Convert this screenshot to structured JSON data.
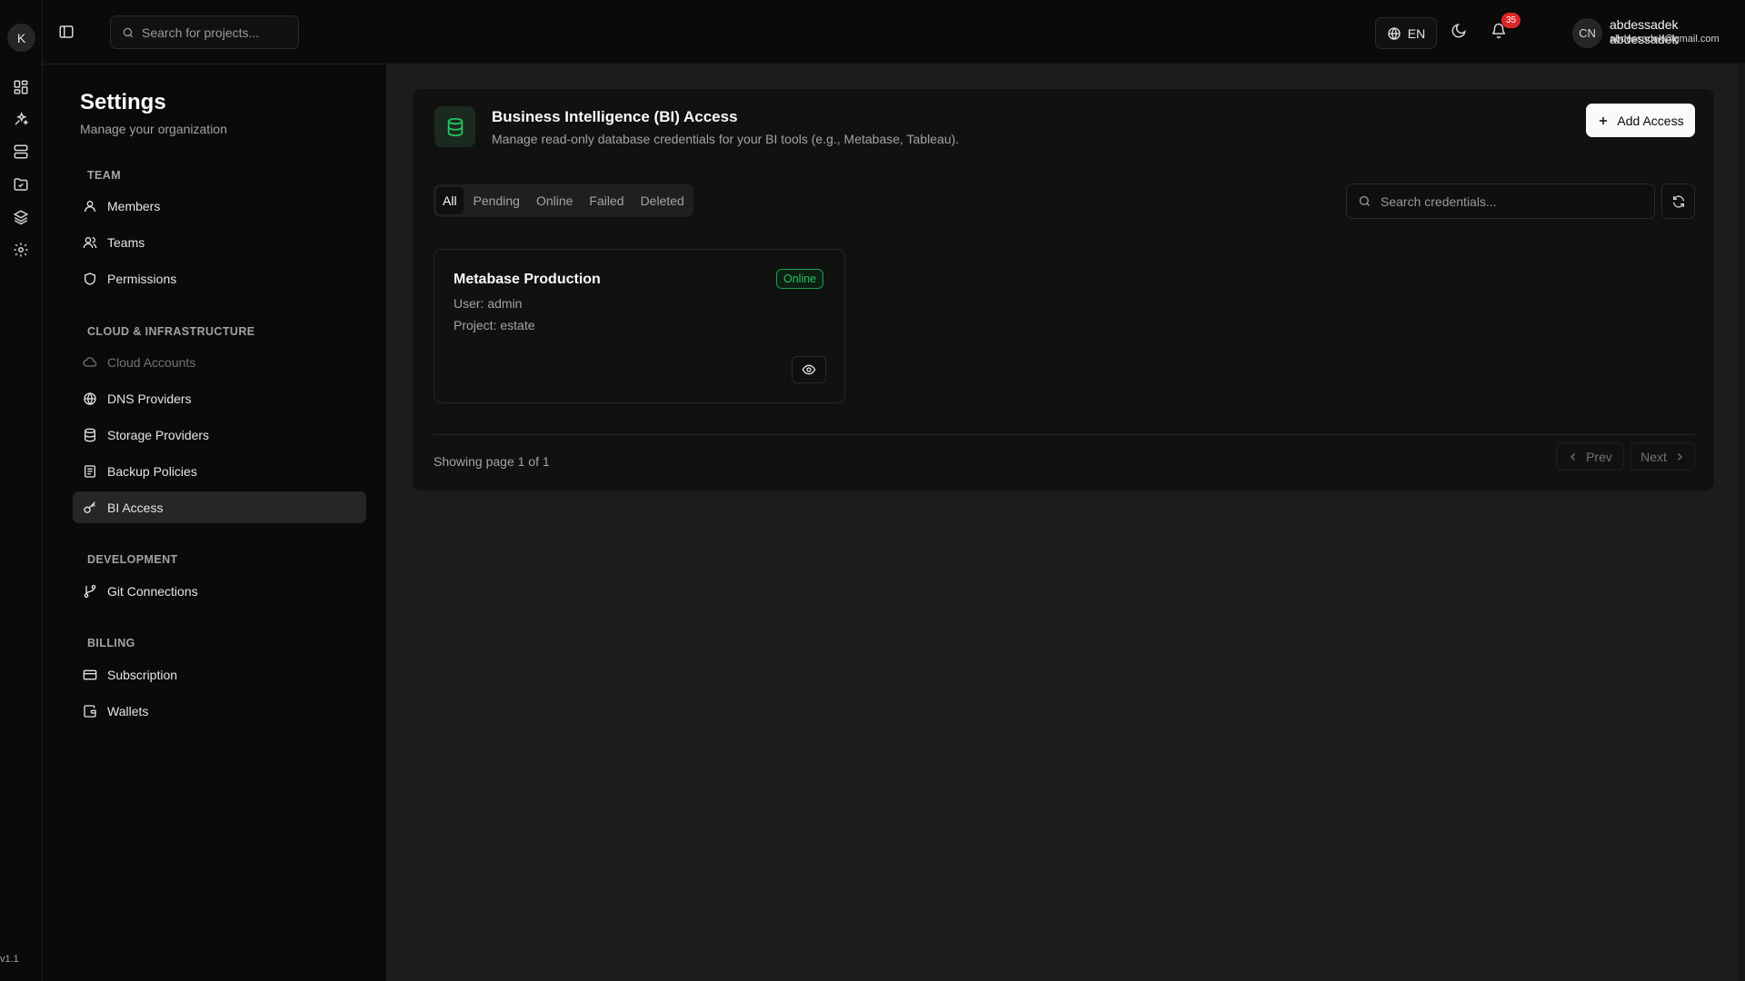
{
  "app": {
    "logo_letter": "K",
    "version": "v1.1"
  },
  "rail": {
    "icons": [
      "dashboard-icon",
      "deploy-icon",
      "servers-icon",
      "projects-folder-icon",
      "layers-icon",
      "settings-gear-icon"
    ]
  },
  "topbar": {
    "search_placeholder": "Search for projects...",
    "language": "EN",
    "notification_count": "35",
    "avatar_initials": "CN",
    "user_name": "abdessadek abdessadek",
    "user_email": "abdessadek@gmail.com"
  },
  "settings_nav": {
    "title": "Settings",
    "subtitle": "Manage your organization",
    "sections": {
      "team": "TEAM",
      "cloud": "CLOUD & INFRASTRUCTURE",
      "development": "DEVELOPMENT",
      "billing": "BILLING"
    },
    "items": {
      "members": "Members",
      "teams": "Teams",
      "permissions": "Permissions",
      "cloud_accounts": "Cloud Accounts",
      "dns_providers": "DNS Providers",
      "storage_providers": "Storage Providers",
      "backup_policies": "Backup Policies",
      "bi_access": "BI Access",
      "git_connections": "Git Connections",
      "subscription": "Subscription",
      "wallets": "Wallets"
    },
    "active_item": "bi_access"
  },
  "main": {
    "header": {
      "title": "Business Intelligence (BI) Access",
      "subtitle": "Manage read-only database credentials for your BI tools (e.g., Metabase, Tableau).",
      "add_button": "Add Access"
    },
    "tabs": [
      "All",
      "Pending",
      "Online",
      "Failed",
      "Deleted"
    ],
    "active_tab": "All",
    "search_placeholder": "Search credentials...",
    "credentials": [
      {
        "name": "Metabase Production",
        "user": "User: admin",
        "project": "Project: estate",
        "status": "Online"
      }
    ],
    "pagination": {
      "info": "Showing page 1 of 1",
      "prev": "Prev",
      "next": "Next"
    }
  },
  "colors": {
    "background": "#0a0a0a",
    "main_background": "#1c1c1c",
    "accent_green": "#22c55e",
    "badge_red": "#dc2626"
  }
}
